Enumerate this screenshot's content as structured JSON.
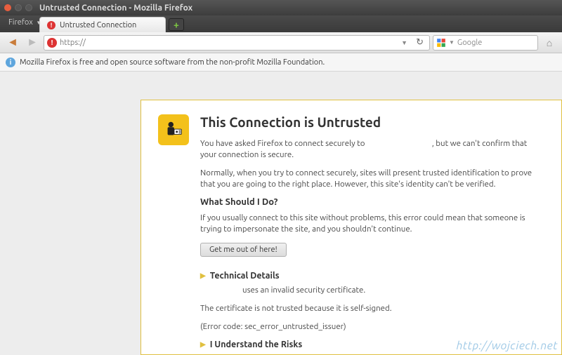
{
  "window": {
    "title": "Untrusted Connection - Mozilla Firefox"
  },
  "menubar": {
    "firefox": "Firefox"
  },
  "tab": {
    "label": "Untrusted Connection"
  },
  "urlbar": {
    "scheme": "https://"
  },
  "searchbar": {
    "placeholder": "Google"
  },
  "infobar": {
    "message": "Mozilla Firefox is free and open source software from the non-profit Mozilla Foundation."
  },
  "error": {
    "heading": "This Connection is Untrusted",
    "p1a": "You have asked Firefox to connect securely to ",
    "p1b": ", but we can't confirm that your connection is secure.",
    "p2": "Normally, when you try to connect securely, sites will present trusted identification to prove that you are going to the right place. However, this site's identity can't be verified.",
    "h2a": "What Should I Do?",
    "p3": "If you usually connect to this site without problems, this error could mean that someone is trying to impersonate the site, and you shouldn't continue.",
    "button": "Get me out of here!",
    "tech_title": "Technical Details",
    "tech_line1": "uses an invalid security certificate.",
    "tech_line2": "The certificate is not trusted because it is self-signed.",
    "tech_line3": "(Error code: sec_error_untrusted_issuer)",
    "risks_title": "I Understand the Risks"
  },
  "watermark": "http://wojciech.net"
}
